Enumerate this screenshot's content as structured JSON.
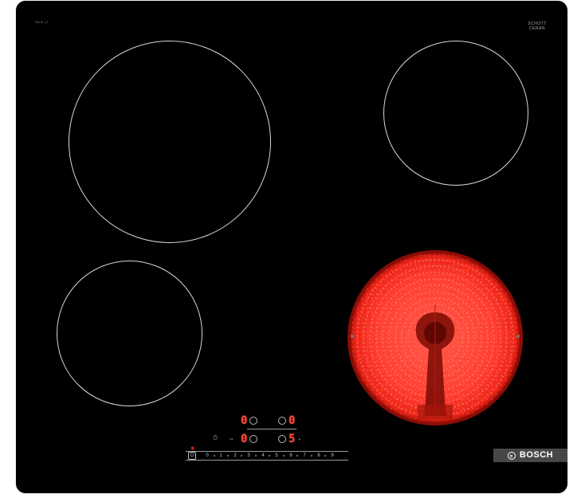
{
  "image": {
    "subject": "black ceramic electric cooktop with four cooking zones, lower-right zone glowing red",
    "background_color": "#ffffff",
    "surface_color": "#000000",
    "glow_color": "#ff3a2e",
    "zone_outline_color": "#d8d8d8"
  },
  "labels": {
    "top_left_text": "Serie | 2",
    "schott_line1": "SCHOTT",
    "schott_line2": "CERAN",
    "schott_sub": ""
  },
  "controls": {
    "left_display_top": "0",
    "right_display_top": "0",
    "left_display_bottom": "0",
    "right_display_bottom": "5",
    "scale": [
      "0",
      "1",
      "2",
      "3",
      "4",
      "5",
      "6",
      "7",
      "8",
      "9"
    ],
    "icons": [
      "power-icon",
      "timer-icon",
      "lock-icon",
      "hot-indicator-icon"
    ]
  },
  "brand": {
    "name": "BOSCH",
    "logo_icon": "bosch-armature-icon"
  }
}
